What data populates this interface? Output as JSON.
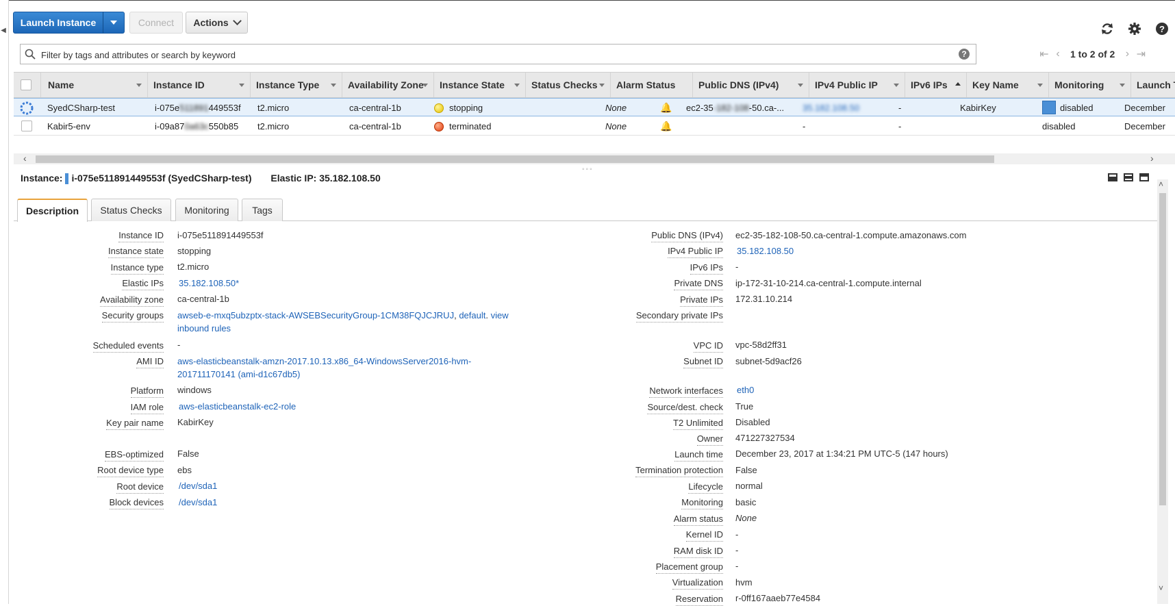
{
  "toolbar": {
    "launch_label": "Launch Instance",
    "connect_label": "Connect",
    "actions_label": "Actions"
  },
  "icons": {
    "refresh": "refresh-icon",
    "settings": "gear-icon",
    "help": "help-icon"
  },
  "search": {
    "placeholder": "Filter by tags and attributes or search by keyword",
    "value": ""
  },
  "pager": {
    "text": "1 to 2 of 2"
  },
  "columns": [
    "Name",
    "Instance ID",
    "Instance Type",
    "Availability Zone",
    "Instance State",
    "Status Checks",
    "Alarm Status",
    "Public DNS (IPv4)",
    "IPv4 Public IP",
    "IPv6 IPs",
    "Key Name",
    "Monitoring",
    "Launch Ti"
  ],
  "rows": [
    {
      "name": "SyedCSharp-test",
      "instance_id_prefix": "i-075e",
      "instance_id_blurred": "511891",
      "instance_id_suffix": "449553f",
      "instance_type": "t2.micro",
      "zone": "ca-central-1b",
      "state": "stopping",
      "status_checks": "",
      "alarm": "None",
      "dns_prefix": "ec2-35",
      "dns_blurred": "-182-108",
      "dns_suffix": "-50.ca-...",
      "ipv4": "35.182.108.50",
      "ipv6": "-",
      "key": "KabirKey",
      "monitoring": "disabled",
      "launch": "December"
    },
    {
      "name": "Kabir5-env",
      "instance_id_prefix": "i-09a87",
      "instance_id_blurred": "0a63c",
      "instance_id_suffix": "550b85",
      "instance_type": "t2.micro",
      "zone": "ca-central-1b",
      "state": "terminated",
      "status_checks": "",
      "alarm": "None",
      "dns_prefix": "",
      "dns_blurred": "",
      "dns_suffix": "",
      "ipv4": "-",
      "ipv6": "-",
      "key": "",
      "monitoring": "disabled",
      "launch": "December"
    }
  ],
  "details": {
    "instance_label": "Instance:",
    "instance_value": "i-075e511891449553f (SyedCSharp-test)",
    "elastic_ip_label": "Elastic IP: 35.182.108.50",
    "tabs": [
      "Description",
      "Status Checks",
      "Monitoring",
      "Tags"
    ],
    "left": [
      {
        "label": "Instance ID",
        "value": "i-075e511891449553f"
      },
      {
        "label": "Instance state",
        "value": "stopping"
      },
      {
        "label": "Instance type",
        "value": "t2.micro"
      },
      {
        "label": "Elastic IPs",
        "value": "35.182.108.50*"
      },
      {
        "label": "Availability zone",
        "value": "ca-central-1b"
      },
      {
        "label": "Security groups",
        "value": "awseb-e-mxq5ubzptx-stack-AWSEBSecurityGroup-1CM38FQJCJRUJ",
        "value_2": "default",
        "value_3": "view",
        "value_4": "inbound rules"
      },
      {
        "label": "Scheduled events",
        "value": "-"
      },
      {
        "label": "AMI ID",
        "value": "aws-elasticbeanstalk-amzn-2017.10.13.x86_64-WindowsServer2016-hvm-",
        "value_2": "201711170141 (ami-d1c67db5)"
      },
      {
        "label": "Platform",
        "value": "windows"
      },
      {
        "label": "IAM role",
        "value": "aws-elasticbeanstalk-ec2-role"
      },
      {
        "label": "Key pair name",
        "value": "KabirKey"
      },
      {
        "label": "EBS-optimized",
        "value": "False"
      },
      {
        "label": "Root device type",
        "value": "ebs"
      },
      {
        "label": "Root device",
        "value": "/dev/sda1"
      },
      {
        "label": "Block devices",
        "value": "/dev/sda1"
      }
    ],
    "right": [
      {
        "label": "Public DNS (IPv4)",
        "value": "ec2-35-182-108-50.ca-central-1.compute.amazonaws.com"
      },
      {
        "label": "IPv4 Public IP",
        "value": "35.182.108.50"
      },
      {
        "label": "IPv6 IPs",
        "value": "-"
      },
      {
        "label": "Private DNS",
        "value": "ip-172-31-10-214.ca-central-1.compute.internal"
      },
      {
        "label": "Private IPs",
        "value": "172.31.10.214"
      },
      {
        "label": "Secondary private IPs",
        "value": ""
      },
      {
        "label": "VPC ID",
        "value": "vpc-58d2ff31"
      },
      {
        "label": "Subnet ID",
        "value": "subnet-5d9acf26"
      },
      {
        "label": "Network interfaces",
        "value": "eth0"
      },
      {
        "label": "Source/dest. check",
        "value": "True"
      },
      {
        "label": "T2 Unlimited",
        "value": "Disabled"
      },
      {
        "label": "Owner",
        "value": "471227327534"
      },
      {
        "label": "Launch time",
        "value": "December 23, 2017 at 1:34:21 PM UTC-5 (147 hours)"
      },
      {
        "label": "Termination protection",
        "value": "False"
      },
      {
        "label": "Lifecycle",
        "value": "normal"
      },
      {
        "label": "Monitoring",
        "value": "basic"
      },
      {
        "label": "Alarm status",
        "value": "None"
      },
      {
        "label": "Kernel ID",
        "value": "-"
      },
      {
        "label": "RAM disk ID",
        "value": "-"
      },
      {
        "label": "Placement group",
        "value": "-"
      },
      {
        "label": "Virtualization",
        "value": "hvm"
      },
      {
        "label": "Reservation",
        "value": "r-0ff167aaeb77e4584"
      }
    ]
  }
}
